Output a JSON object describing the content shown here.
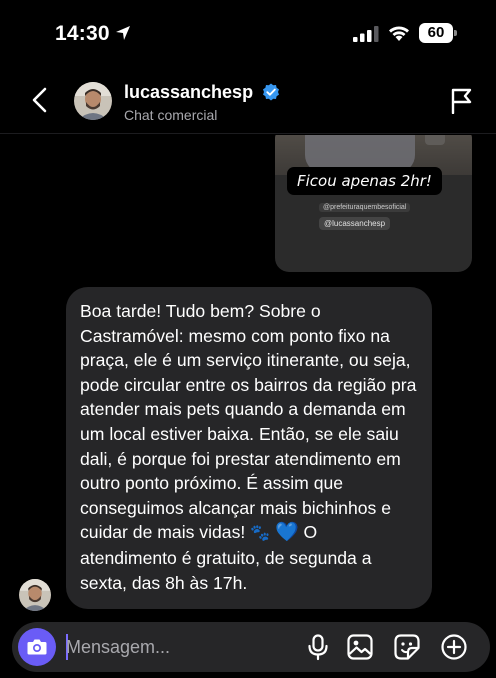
{
  "status_bar": {
    "time": "14:30",
    "battery": "60"
  },
  "header": {
    "username": "lucassanchesp",
    "subtitle": "Chat comercial"
  },
  "shared_media": {
    "caption": "Ficou apenas 2hr!",
    "tag_small": "@prefeituraquembesoficial",
    "tag_mention": "@lucassanchesp"
  },
  "message": {
    "text_before_emoji": "Boa tarde! Tudo bem? Sobre o Castramóvel: mesmo com ponto fixo na praça, ele é um serviço itinerante, ou seja, pode circular entre os bairros da região pra atender mais pets quando a demanda em um local estiver baixa. Então, se ele saiu dali, é porque foi prestar atendimento em outro ponto próximo. É assim que conseguimos alcançar mais bichinhos e cuidar de mais vidas!",
    "emoji_paws": "🐾",
    "emoji_heart": "💙",
    "text_after_emoji": "O atendimento é gratuito, de segunda a sexta, das 8h às 17h."
  },
  "composer": {
    "placeholder": "Mensagem..."
  },
  "icons": {
    "back": "chevron-left-icon",
    "verified": "verified-badge-icon",
    "report": "flag-icon",
    "camera": "camera-icon",
    "mic": "microphone-icon",
    "gallery": "image-icon",
    "sticker": "sticker-icon",
    "plus": "plus-circle-icon"
  },
  "colors": {
    "background": "#000000",
    "bubble": "#262628",
    "accent": "#6a5cf6",
    "verified": "#3797f0"
  }
}
